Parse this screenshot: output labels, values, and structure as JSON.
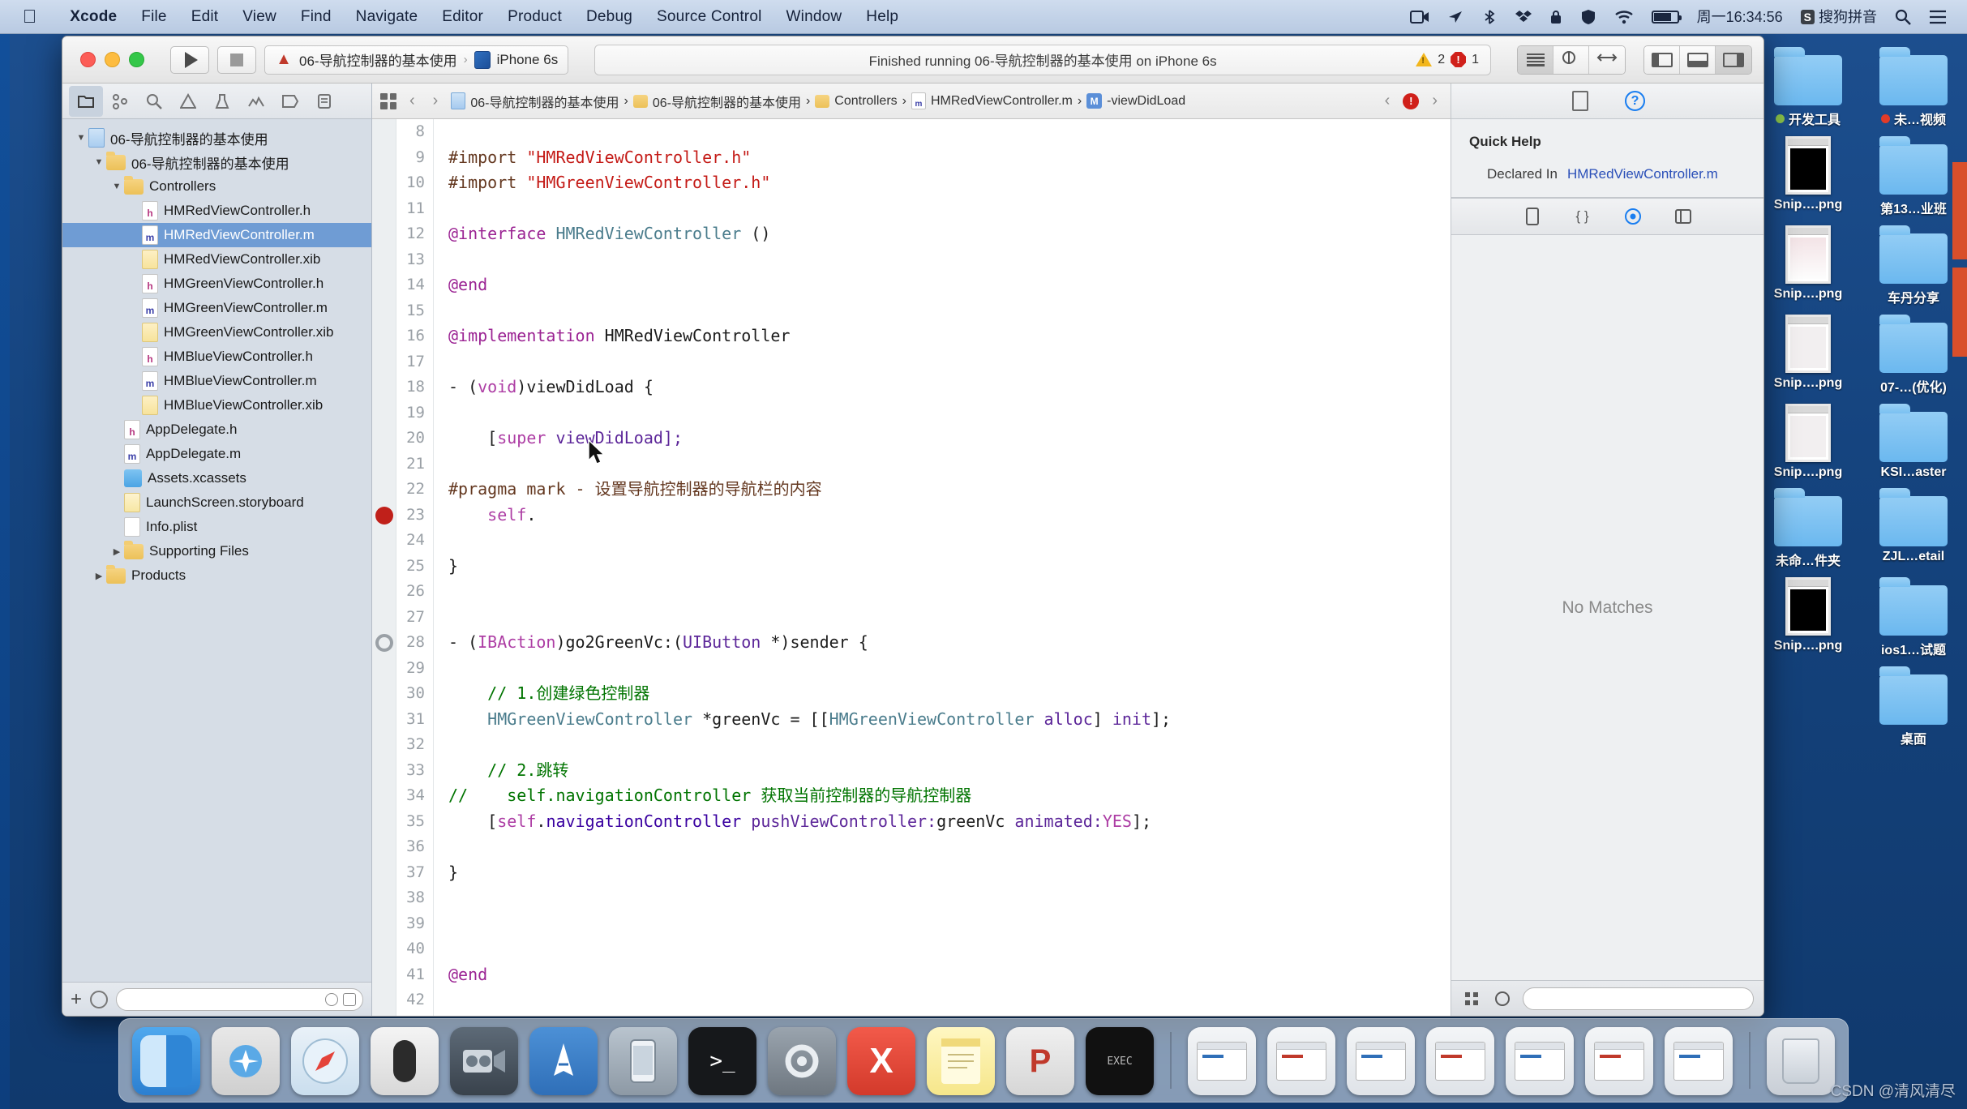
{
  "menubar": {
    "apple_icon": "apple-icon",
    "items": [
      {
        "label": "Xcode",
        "bold": true
      },
      {
        "label": "File",
        "bold": false
      },
      {
        "label": "Edit",
        "bold": false
      },
      {
        "label": "View",
        "bold": false
      },
      {
        "label": "Find",
        "bold": false
      },
      {
        "label": "Navigate",
        "bold": false
      },
      {
        "label": "Editor",
        "bold": false
      },
      {
        "label": "Product",
        "bold": false
      },
      {
        "label": "Debug",
        "bold": false
      },
      {
        "label": "Source Control",
        "bold": false
      },
      {
        "label": "Window",
        "bold": false
      },
      {
        "label": "Help",
        "bold": false
      }
    ],
    "status_icons": [
      "screen-record-icon",
      "location-icon",
      "bluetooth-share-icon",
      "dropbox-icon",
      "lock-icon",
      "shield-icon",
      "wifi-icon",
      "battery-icon"
    ],
    "clock": "周一16:34:56",
    "ime_badge": "S",
    "ime_label": "搜狗拼音",
    "search_icon": "search-icon",
    "control_center_icon": "list-icon"
  },
  "xcode": {
    "toolbar": {
      "run_icon": "play-icon",
      "stop_icon": "stop-icon",
      "scheme_project": "06-导航控制器的基本使用",
      "scheme_separator": "›",
      "scheme_device": "iPhone 6s",
      "status_text": "Finished running 06-导航控制器的基本使用 on iPhone 6s",
      "warning_count": "2",
      "error_count": "1",
      "editor_segments": [
        "standard-editor-icon",
        "assistant-editor-icon",
        "version-editor-icon"
      ],
      "view_segments": [
        "show-navigator-icon",
        "show-debug-area-icon",
        "show-inspector-icon"
      ]
    },
    "navigator": {
      "tabs": [
        "project-navigator-icon",
        "source-control-navigator-icon",
        "find-navigator-icon",
        "issue-navigator-icon",
        "test-navigator-icon",
        "debug-navigator-icon",
        "breakpoint-navigator-icon",
        "report-navigator-icon"
      ],
      "tree": [
        {
          "label": "06-导航控制器的基本使用",
          "indent": 0,
          "twisty": "▼",
          "icon": "project",
          "selected": false
        },
        {
          "label": "06-导航控制器的基本使用",
          "indent": 1,
          "twisty": "▼",
          "icon": "folder",
          "selected": false
        },
        {
          "label": "Controllers",
          "indent": 2,
          "twisty": "▼",
          "icon": "folder",
          "selected": false
        },
        {
          "label": "HMRedViewController.h",
          "indent": 3,
          "twisty": "",
          "icon": "h",
          "selected": false
        },
        {
          "label": "HMRedViewController.m",
          "indent": 3,
          "twisty": "",
          "icon": "m",
          "selected": true
        },
        {
          "label": "HMRedViewController.xib",
          "indent": 3,
          "twisty": "",
          "icon": "xib",
          "selected": false
        },
        {
          "label": "HMGreenViewController.h",
          "indent": 3,
          "twisty": "",
          "icon": "h",
          "selected": false
        },
        {
          "label": "HMGreenViewController.m",
          "indent": 3,
          "twisty": "",
          "icon": "m",
          "selected": false
        },
        {
          "label": "HMGreenViewController.xib",
          "indent": 3,
          "twisty": "",
          "icon": "xib",
          "selected": false
        },
        {
          "label": "HMBlueViewController.h",
          "indent": 3,
          "twisty": "",
          "icon": "h",
          "selected": false
        },
        {
          "label": "HMBlueViewController.m",
          "indent": 3,
          "twisty": "",
          "icon": "m",
          "selected": false
        },
        {
          "label": "HMBlueViewController.xib",
          "indent": 3,
          "twisty": "",
          "icon": "xib",
          "selected": false
        },
        {
          "label": "AppDelegate.h",
          "indent": 2,
          "twisty": "",
          "icon": "h",
          "selected": false
        },
        {
          "label": "AppDelegate.m",
          "indent": 2,
          "twisty": "",
          "icon": "m",
          "selected": false
        },
        {
          "label": "Assets.xcassets",
          "indent": 2,
          "twisty": "",
          "icon": "xca",
          "selected": false
        },
        {
          "label": "LaunchScreen.storyboard",
          "indent": 2,
          "twisty": "",
          "icon": "story",
          "selected": false
        },
        {
          "label": "Info.plist",
          "indent": 2,
          "twisty": "",
          "icon": "plist",
          "selected": false
        },
        {
          "label": "Supporting Files",
          "indent": 2,
          "twisty": "▶",
          "icon": "folder",
          "selected": false
        },
        {
          "label": "Products",
          "indent": 1,
          "twisty": "▶",
          "icon": "folder",
          "selected": false
        }
      ],
      "filter_placeholder": ""
    },
    "jumpbar": {
      "crumbs": [
        {
          "label": "06-导航控制器的基本使用",
          "icon": "projblue"
        },
        {
          "label": "06-导航控制器的基本使用",
          "icon": "fold"
        },
        {
          "label": "Controllers",
          "icon": "fold"
        },
        {
          "label": "HMRedViewController.m",
          "icon": "msrc"
        },
        {
          "label": "-viewDidLoad",
          "icon": "mblue"
        }
      ],
      "related_items_icon": "related-items-icon",
      "back_icon": "back-chevron-icon",
      "forward_icon": "forward-chevron-icon",
      "prev_issue_icon": "previous-issue-icon",
      "next_issue_icon": "next-issue-icon"
    },
    "code": {
      "first_line_number": 8,
      "lines": [
        {
          "n": 8,
          "tokens": [
            {
              "t": "",
              "c": ""
            }
          ],
          "marker": ""
        },
        {
          "n": 9,
          "tokens": [
            {
              "t": "#import ",
              "c": "pp"
            },
            {
              "t": "\"HMRedViewController.h\"",
              "c": "str"
            }
          ],
          "marker": ""
        },
        {
          "n": 10,
          "tokens": [
            {
              "t": "#import ",
              "c": "pp"
            },
            {
              "t": "\"HMGreenViewController.h\"",
              "c": "str"
            }
          ],
          "marker": ""
        },
        {
          "n": 11,
          "tokens": [
            {
              "t": "",
              "c": ""
            }
          ],
          "marker": ""
        },
        {
          "n": 12,
          "tokens": [
            {
              "t": "@interface ",
              "c": "kb"
            },
            {
              "t": "HMRedViewController",
              "c": "ty"
            },
            {
              "t": " ()",
              "c": "nm"
            }
          ],
          "marker": ""
        },
        {
          "n": 13,
          "tokens": [
            {
              "t": "",
              "c": ""
            }
          ],
          "marker": ""
        },
        {
          "n": 14,
          "tokens": [
            {
              "t": "@end",
              "c": "kb"
            }
          ],
          "marker": ""
        },
        {
          "n": 15,
          "tokens": [
            {
              "t": "",
              "c": ""
            }
          ],
          "marker": ""
        },
        {
          "n": 16,
          "tokens": [
            {
              "t": "@implementation ",
              "c": "kb"
            },
            {
              "t": "HMRedViewController",
              "c": "nm"
            }
          ],
          "marker": ""
        },
        {
          "n": 17,
          "tokens": [
            {
              "t": "",
              "c": ""
            }
          ],
          "marker": ""
        },
        {
          "n": 18,
          "tokens": [
            {
              "t": "- (",
              "c": "nm"
            },
            {
              "t": "void",
              "c": "k"
            },
            {
              "t": ")viewDidLoad {",
              "c": "nm"
            }
          ],
          "marker": ""
        },
        {
          "n": 19,
          "tokens": [
            {
              "t": "",
              "c": ""
            }
          ],
          "marker": ""
        },
        {
          "n": 20,
          "tokens": [
            {
              "t": "    [",
              "c": "nm"
            },
            {
              "t": "super",
              "c": "k"
            },
            {
              "t": " viewDidLoad];",
              "c": "tyb"
            }
          ],
          "marker": ""
        },
        {
          "n": 21,
          "tokens": [
            {
              "t": "",
              "c": ""
            }
          ],
          "marker": ""
        },
        {
          "n": 22,
          "tokens": [
            {
              "t": "#pragma mark ",
              "c": "pp"
            },
            {
              "t": "- 设置导航控制器的导航栏的内容",
              "c": "pp"
            }
          ],
          "marker": ""
        },
        {
          "n": 23,
          "tokens": [
            {
              "t": "    ",
              "c": "nm"
            },
            {
              "t": "self",
              "c": "k"
            },
            {
              "t": ".",
              "c": "nm"
            }
          ],
          "marker": "breakpoint-red"
        },
        {
          "n": 24,
          "tokens": [
            {
              "t": "",
              "c": ""
            }
          ],
          "marker": ""
        },
        {
          "n": 25,
          "tokens": [
            {
              "t": "}",
              "c": "nm"
            }
          ],
          "marker": ""
        },
        {
          "n": 26,
          "tokens": [
            {
              "t": "",
              "c": ""
            }
          ],
          "marker": ""
        },
        {
          "n": 27,
          "tokens": [
            {
              "t": "",
              "c": ""
            }
          ],
          "marker": ""
        },
        {
          "n": 28,
          "tokens": [
            {
              "t": "- (",
              "c": "nm"
            },
            {
              "t": "IBAction",
              "c": "k"
            },
            {
              "t": ")go2GreenVc:(",
              "c": "nm"
            },
            {
              "t": "UIButton",
              "c": "tyb"
            },
            {
              "t": " *)sender {",
              "c": "nm"
            }
          ],
          "marker": "breakpoint-disabled"
        },
        {
          "n": 29,
          "tokens": [
            {
              "t": "",
              "c": ""
            }
          ],
          "marker": ""
        },
        {
          "n": 30,
          "tokens": [
            {
              "t": "    // 1.创建绿色控制器",
              "c": "cm"
            }
          ],
          "marker": ""
        },
        {
          "n": 31,
          "tokens": [
            {
              "t": "    ",
              "c": "nm"
            },
            {
              "t": "HMGreenViewController",
              "c": "ty"
            },
            {
              "t": " *greenVc = [[",
              "c": "nm"
            },
            {
              "t": "HMGreenViewController",
              "c": "ty"
            },
            {
              "t": " alloc",
              "c": "tyb"
            },
            {
              "t": "] ",
              "c": "nm"
            },
            {
              "t": "init",
              "c": "tyb"
            },
            {
              "t": "];",
              "c": "nm"
            }
          ],
          "marker": ""
        },
        {
          "n": 32,
          "tokens": [
            {
              "t": "",
              "c": ""
            }
          ],
          "marker": ""
        },
        {
          "n": 33,
          "tokens": [
            {
              "t": "    // 2.跳转",
              "c": "cm"
            }
          ],
          "marker": ""
        },
        {
          "n": 34,
          "tokens": [
            {
              "t": "//    self.navigationController 获取当前控制器的导航控制器",
              "c": "cm"
            }
          ],
          "marker": ""
        },
        {
          "n": 35,
          "tokens": [
            {
              "t": "    [",
              "c": "nm"
            },
            {
              "t": "self",
              "c": "k"
            },
            {
              "t": ".",
              "c": "nm"
            },
            {
              "t": "navigationController",
              "c": "pr"
            },
            {
              "t": " pushViewController:",
              "c": "tyb"
            },
            {
              "t": "greenVc",
              "c": "nm"
            },
            {
              "t": " animated:",
              "c": "tyb"
            },
            {
              "t": "YES",
              "c": "k"
            },
            {
              "t": "];",
              "c": "nm"
            }
          ],
          "marker": ""
        },
        {
          "n": 36,
          "tokens": [
            {
              "t": "",
              "c": ""
            }
          ],
          "marker": ""
        },
        {
          "n": 37,
          "tokens": [
            {
              "t": "}",
              "c": "nm"
            }
          ],
          "marker": ""
        },
        {
          "n": 38,
          "tokens": [
            {
              "t": "",
              "c": ""
            }
          ],
          "marker": ""
        },
        {
          "n": 39,
          "tokens": [
            {
              "t": "",
              "c": ""
            }
          ],
          "marker": ""
        },
        {
          "n": 40,
          "tokens": [
            {
              "t": "",
              "c": ""
            }
          ],
          "marker": ""
        },
        {
          "n": 41,
          "tokens": [
            {
              "t": "@end",
              "c": "kb"
            }
          ],
          "marker": ""
        },
        {
          "n": 42,
          "tokens": [
            {
              "t": "",
              "c": ""
            }
          ],
          "marker": ""
        }
      ]
    },
    "inspector": {
      "tabs": [
        "file-inspector-icon",
        "quick-help-inspector-icon"
      ],
      "quick_help_title": "Quick Help",
      "declared_in_label": "Declared In",
      "declared_in_value": "HMRedViewController.m",
      "library_tabs": [
        "file-template-library-icon",
        "code-snippet-library-icon",
        "object-library-icon",
        "media-library-icon"
      ],
      "library_empty": "No Matches",
      "library_filter_placeholder": ""
    }
  },
  "desktop": {
    "icons": [
      {
        "label": "开发工具",
        "type": "folder",
        "dot": "green"
      },
      {
        "label": "未…视频",
        "type": "folder",
        "dot": "red"
      },
      {
        "label": "Snip….png",
        "type": "file-dark",
        "dot": ""
      },
      {
        "label": "第13…业班",
        "type": "folder",
        "dot": ""
      },
      {
        "label": "Snip….png",
        "type": "file-pink",
        "dot": ""
      },
      {
        "label": "车丹分享",
        "type": "folder",
        "dot": ""
      },
      {
        "label": "Snip….png",
        "type": "file-light",
        "dot": ""
      },
      {
        "label": "07-…(优化)",
        "type": "folder",
        "dot": ""
      },
      {
        "label": "Snip….png",
        "type": "file-light",
        "dot": ""
      },
      {
        "label": "KSI…aster",
        "type": "folder",
        "dot": ""
      },
      {
        "label": "未命…件夹",
        "type": "folder",
        "dot": ""
      },
      {
        "label": "ZJL…etail",
        "type": "folder",
        "dot": ""
      },
      {
        "label": "Snip….png",
        "type": "file-dark",
        "dot": ""
      },
      {
        "label": "ios1…试题",
        "type": "folder",
        "dot": ""
      },
      {
        "label": "",
        "type": "none",
        "dot": ""
      },
      {
        "label": "桌面",
        "type": "folder",
        "dot": ""
      }
    ]
  },
  "dock": {
    "items": [
      {
        "name": "finder-dock-icon",
        "cls": "finder"
      },
      {
        "name": "launchpad-dock-icon",
        "cls": "launchpad"
      },
      {
        "name": "safari-dock-icon",
        "cls": "safari"
      },
      {
        "name": "mouse-app-dock-icon",
        "cls": "mouse"
      },
      {
        "name": "video-app-dock-icon",
        "cls": "video"
      },
      {
        "name": "xcode-dock-icon",
        "cls": "xcode"
      },
      {
        "name": "simulator-dock-icon",
        "cls": "sim"
      },
      {
        "name": "terminal-dock-icon",
        "cls": "term"
      },
      {
        "name": "system-preferences-dock-icon",
        "cls": "pref"
      },
      {
        "name": "xmind-dock-icon",
        "cls": "x"
      },
      {
        "name": "notes-dock-icon",
        "cls": "notes"
      },
      {
        "name": "pycharm-dock-icon",
        "cls": "p"
      },
      {
        "name": "executable-dock-icon",
        "cls": "exec"
      },
      {
        "name": "window-1-dock-icon",
        "cls": "win"
      },
      {
        "name": "window-2-dock-icon",
        "cls": "win"
      },
      {
        "name": "window-3-dock-icon",
        "cls": "win"
      },
      {
        "name": "window-4-dock-icon",
        "cls": "win"
      },
      {
        "name": "window-5-dock-icon",
        "cls": "win"
      },
      {
        "name": "window-6-dock-icon",
        "cls": "win"
      },
      {
        "name": "window-7-dock-icon",
        "cls": "win"
      },
      {
        "name": "trash-dock-icon",
        "cls": "trash"
      }
    ]
  },
  "watermark": "CSDN @清风清尽"
}
